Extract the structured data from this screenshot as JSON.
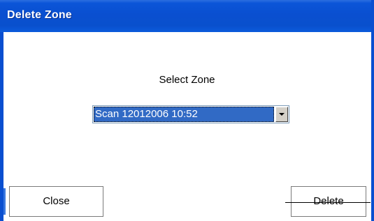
{
  "window": {
    "title": "Delete Zone"
  },
  "form": {
    "select_label": "Select Zone",
    "zone_select": {
      "selected_value": "Scan 12012006 10:52"
    }
  },
  "buttons": {
    "close_label": "Close",
    "delete_label": "Delete"
  },
  "colors": {
    "titlebar": "#0a4fd0",
    "selection": "#316ac5"
  },
  "icons": {
    "dropdown": "chevron-down-icon"
  }
}
